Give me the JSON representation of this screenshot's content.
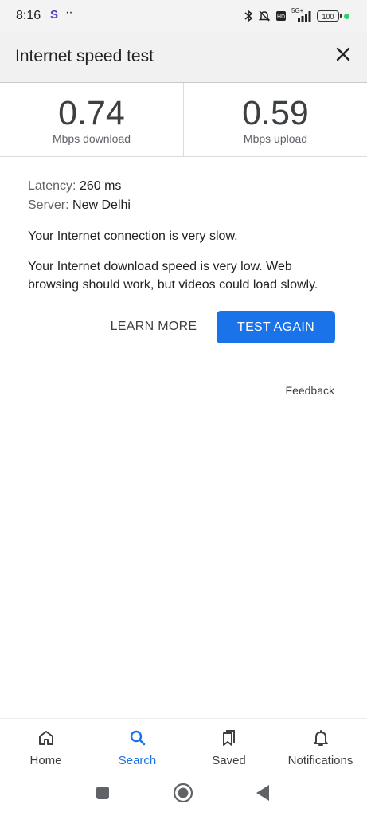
{
  "status_bar": {
    "time": "8:16",
    "app_badge": "S",
    "dots": "··",
    "network": "5G+",
    "battery": "100"
  },
  "header": {
    "title": "Internet speed test"
  },
  "results": {
    "download_value": "0.74",
    "download_label": "Mbps download",
    "upload_value": "0.59",
    "upload_label": "Mbps upload"
  },
  "details": {
    "latency_key": "Latency:",
    "latency_value": "260 ms",
    "server_key": "Server:",
    "server_value": "New Delhi",
    "message_1": "Your Internet connection is very slow.",
    "message_2": "Your Internet download speed is very low. Web browsing should work, but videos could load slowly."
  },
  "actions": {
    "learn_more": "LEARN MORE",
    "test_again": "TEST AGAIN",
    "feedback": "Feedback"
  },
  "bottom_nav": {
    "items": [
      {
        "label": "Home",
        "icon": "home-icon",
        "active": false
      },
      {
        "label": "Search",
        "icon": "search-icon",
        "active": true
      },
      {
        "label": "Saved",
        "icon": "bookmarks-icon",
        "active": false
      },
      {
        "label": "Notifications",
        "icon": "bell-icon",
        "active": false
      }
    ]
  },
  "colors": {
    "accent": "#1a73e8",
    "header_bg": "#f1f1f1",
    "status_dot": "#2bd46a",
    "app_badge": "#5b3cc4"
  }
}
